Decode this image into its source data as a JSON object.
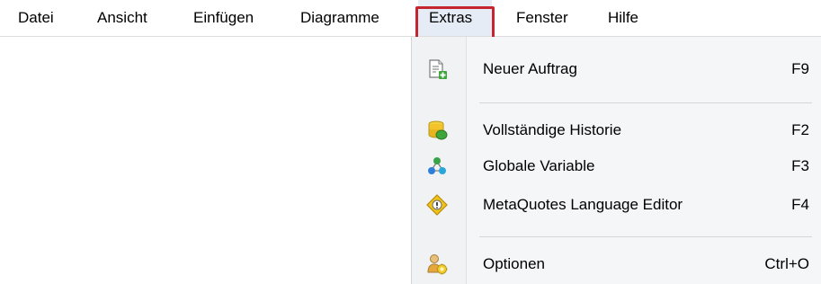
{
  "menubar": {
    "items": [
      {
        "label": "Datei"
      },
      {
        "label": "Ansicht"
      },
      {
        "label": "Einfügen"
      },
      {
        "label": "Diagramme"
      },
      {
        "label": "Extras"
      },
      {
        "label": "Fenster"
      },
      {
        "label": "Hilfe"
      }
    ],
    "active": "Extras",
    "highlight_color": "#c4252e"
  },
  "extras_menu": {
    "items": [
      {
        "label": "Neuer Auftrag",
        "shortcut": "F9",
        "icon": "new-order-icon"
      },
      {
        "label": "Vollständige Historie",
        "shortcut": "F2",
        "icon": "database-icon"
      },
      {
        "label": "Globale Variable",
        "shortcut": "F3",
        "icon": "global-variables-icon"
      },
      {
        "label": "MetaQuotes Language Editor",
        "shortcut": "F4",
        "icon": "metaeditor-icon"
      },
      {
        "label": "Optionen",
        "shortcut": "Ctrl+O",
        "icon": "options-icon"
      }
    ]
  }
}
